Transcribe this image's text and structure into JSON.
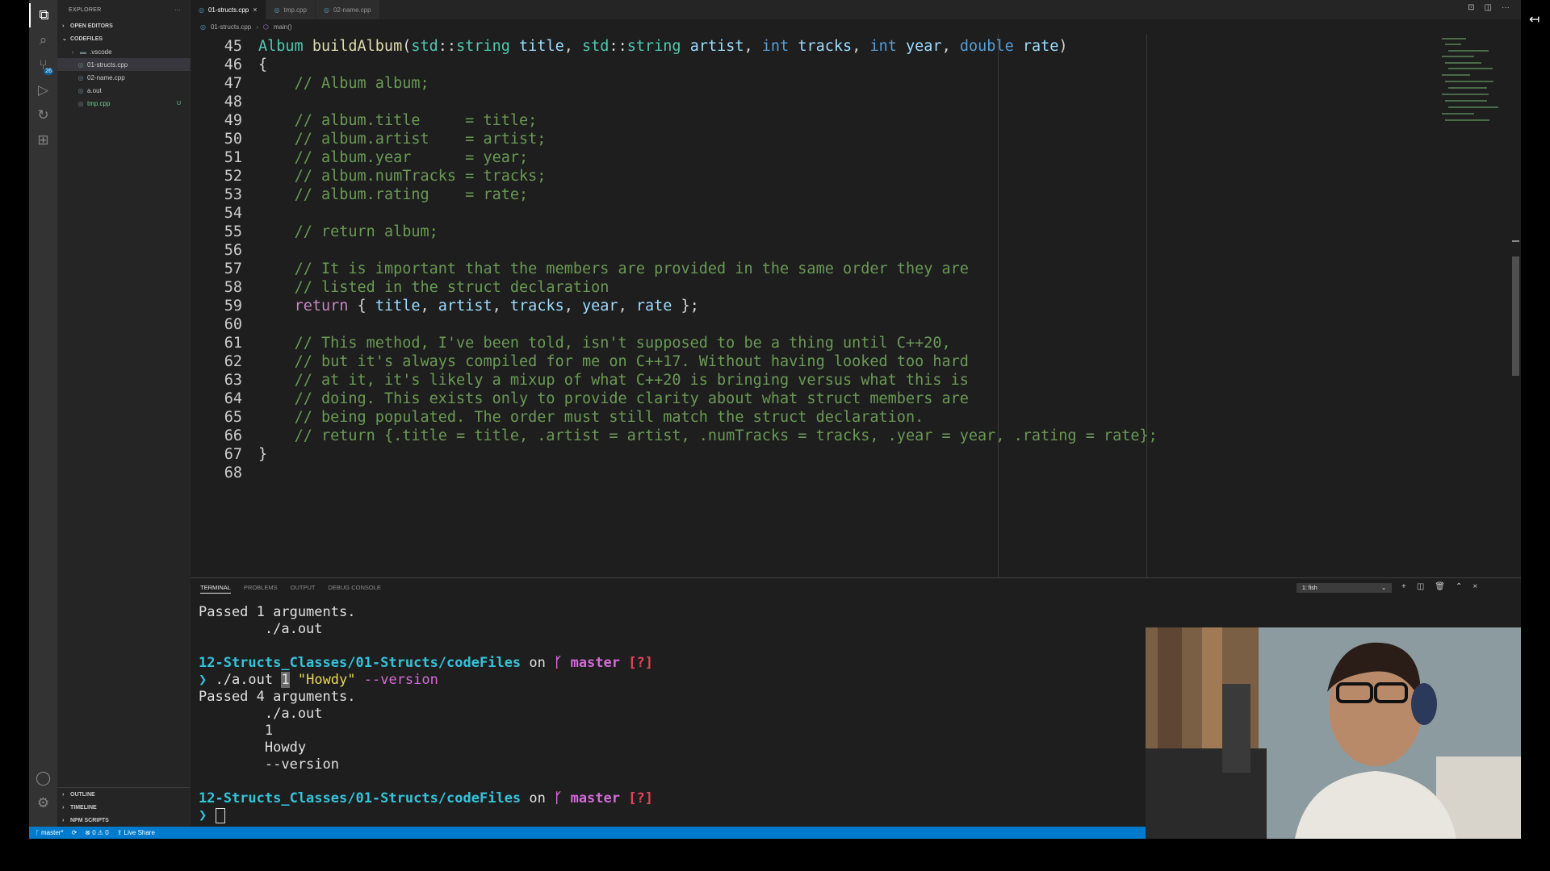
{
  "activity_bar": {
    "items": [
      {
        "name": "explorer-icon",
        "glyph": "⧉",
        "active": true
      },
      {
        "name": "search-icon",
        "glyph": "⌕"
      },
      {
        "name": "source-control-icon",
        "glyph": "⑂",
        "badge": "26"
      },
      {
        "name": "run-debug-icon",
        "glyph": "▷"
      },
      {
        "name": "live-share-icon",
        "glyph": "↻"
      },
      {
        "name": "extensions-icon",
        "glyph": "⊞"
      }
    ],
    "bottom": [
      {
        "name": "account-icon",
        "glyph": "◯"
      },
      {
        "name": "settings-gear-icon",
        "glyph": "⚙"
      }
    ]
  },
  "sidebar": {
    "title": "EXPLORER",
    "more": "···",
    "open_editors": "OPEN EDITORS",
    "folder": "CODEFILES",
    "items": [
      {
        "label": ".vscode",
        "kind": "folder"
      },
      {
        "label": "01-structs.cpp",
        "kind": "file",
        "selected": true
      },
      {
        "label": "02-name.cpp",
        "kind": "file"
      },
      {
        "label": "a.out",
        "kind": "file"
      },
      {
        "label": "tmp.cpp",
        "kind": "file",
        "untracked": true,
        "decoration": "U"
      }
    ],
    "outline": "OUTLINE",
    "timeline": "TIMELINE",
    "npm_scripts": "NPM SCRIPTS"
  },
  "tabs": [
    {
      "label": "01-structs.cpp",
      "active": true,
      "close": "×"
    },
    {
      "label": "tmp.cpp"
    },
    {
      "label": "02-name.cpp"
    }
  ],
  "breadcrumb": {
    "file": "01-structs.cpp",
    "symbol": "main()"
  },
  "code_lines": [
    {
      "n": "45",
      "tokens": [
        [
          "type",
          "Album "
        ],
        [
          "fn",
          "buildAlbum"
        ],
        [
          "p",
          "("
        ],
        [
          "ns",
          "std"
        ],
        [
          "p",
          "::"
        ],
        [
          "type",
          "string"
        ],
        [
          "p",
          " "
        ],
        [
          "var",
          "title"
        ],
        [
          "p",
          ", "
        ],
        [
          "ns",
          "std"
        ],
        [
          "p",
          "::"
        ],
        [
          "type",
          "string"
        ],
        [
          "p",
          " "
        ],
        [
          "var",
          "artist"
        ],
        [
          "p",
          ", "
        ],
        [
          "kw",
          "int"
        ],
        [
          "p",
          " "
        ],
        [
          "var",
          "tracks"
        ],
        [
          "p",
          ", "
        ],
        [
          "kw",
          "int"
        ],
        [
          "p",
          " "
        ],
        [
          "var",
          "year"
        ],
        [
          "p",
          ", "
        ],
        [
          "kw",
          "double"
        ],
        [
          "p",
          " "
        ],
        [
          "var",
          "rate"
        ],
        [
          "p",
          ")"
        ]
      ]
    },
    {
      "n": "46",
      "tokens": [
        [
          "p",
          "{"
        ]
      ]
    },
    {
      "n": "47",
      "tokens": [
        [
          "p",
          "    "
        ],
        [
          "com",
          "// Album album;"
        ]
      ]
    },
    {
      "n": "48",
      "tokens": []
    },
    {
      "n": "49",
      "tokens": [
        [
          "p",
          "    "
        ],
        [
          "com",
          "// album.title     = title;"
        ]
      ]
    },
    {
      "n": "50",
      "tokens": [
        [
          "p",
          "    "
        ],
        [
          "com",
          "// album.artist    = artist;"
        ]
      ]
    },
    {
      "n": "51",
      "tokens": [
        [
          "p",
          "    "
        ],
        [
          "com",
          "// album.year      = year;"
        ]
      ]
    },
    {
      "n": "52",
      "tokens": [
        [
          "p",
          "    "
        ],
        [
          "com",
          "// album.numTracks = tracks;"
        ]
      ]
    },
    {
      "n": "53",
      "tokens": [
        [
          "p",
          "    "
        ],
        [
          "com",
          "// album.rating    = rate;"
        ]
      ]
    },
    {
      "n": "54",
      "tokens": []
    },
    {
      "n": "55",
      "tokens": [
        [
          "p",
          "    "
        ],
        [
          "com",
          "// return album;"
        ]
      ]
    },
    {
      "n": "56",
      "tokens": []
    },
    {
      "n": "57",
      "tokens": [
        [
          "p",
          "    "
        ],
        [
          "com",
          "// It is important that the members are provided in the same order they are"
        ]
      ]
    },
    {
      "n": "58",
      "tokens": [
        [
          "p",
          "    "
        ],
        [
          "com",
          "// listed in the struct declaration"
        ]
      ]
    },
    {
      "n": "59",
      "tokens": [
        [
          "p",
          "    "
        ],
        [
          "kwc",
          "return"
        ],
        [
          "p",
          " { "
        ],
        [
          "var",
          "title"
        ],
        [
          "p",
          ", "
        ],
        [
          "var",
          "artist"
        ],
        [
          "p",
          ", "
        ],
        [
          "var",
          "tracks"
        ],
        [
          "p",
          ", "
        ],
        [
          "var",
          "year"
        ],
        [
          "p",
          ", "
        ],
        [
          "var",
          "rate"
        ],
        [
          "p",
          " };"
        ]
      ]
    },
    {
      "n": "60",
      "tokens": []
    },
    {
      "n": "61",
      "tokens": [
        [
          "p",
          "    "
        ],
        [
          "com",
          "// This method, I've been told, isn't supposed to be a thing until C++20,"
        ]
      ]
    },
    {
      "n": "62",
      "tokens": [
        [
          "p",
          "    "
        ],
        [
          "com",
          "// but it's always compiled for me on C++17. Without having looked too hard"
        ]
      ]
    },
    {
      "n": "63",
      "tokens": [
        [
          "p",
          "    "
        ],
        [
          "com",
          "// at it, it's likely a mixup of what C++20 is bringing versus what this is"
        ]
      ]
    },
    {
      "n": "64",
      "tokens": [
        [
          "p",
          "    "
        ],
        [
          "com",
          "// doing. This exists only to provide clarity about what struct members are"
        ]
      ]
    },
    {
      "n": "65",
      "tokens": [
        [
          "p",
          "    "
        ],
        [
          "com",
          "// being populated. The order must still match the struct declaration."
        ]
      ]
    },
    {
      "n": "66",
      "tokens": [
        [
          "p",
          "    "
        ],
        [
          "com",
          "// return {.title = title, .artist = artist, .numTracks = tracks, .year = year, .rating = rate};"
        ]
      ]
    },
    {
      "n": "67",
      "tokens": [
        [
          "p",
          "}"
        ]
      ]
    },
    {
      "n": "68",
      "tokens": []
    }
  ],
  "panel": {
    "tabs": [
      "TERMINAL",
      "PROBLEMS",
      "OUTPUT",
      "DEBUG CONSOLE"
    ],
    "terminal_select": "1: fish",
    "actions": [
      "+",
      "◫",
      "🗑",
      "⌃",
      "×"
    ]
  },
  "terminal": {
    "path": "12-Structs_Classes/01-Structs/codeFiles",
    "on": " on ",
    "branch_icon": "ᚴ",
    "branch": "master",
    "status": "[?]",
    "prompt": "❯",
    "out1": "Passed 1 arguments.",
    "out1_a": "        ./a.out",
    "cmd_prog": " ./a.out ",
    "cmd_arg1": "1",
    "cmd_arg2": " \"Howdy\"",
    "cmd_arg3": " --version",
    "out2": "Passed 4 arguments.",
    "out2_a": "        ./a.out",
    "out2_b": "        1",
    "out2_c": "        Howdy",
    "out2_d": "        --version"
  },
  "status_bar": {
    "branch": "ᚴ master*",
    "sync": "⟳",
    "problems": "⊗ 0 ⚠ 0",
    "live_share": "⇪ Live Share"
  },
  "editor_actions": [
    "⊡",
    "◫",
    "···"
  ],
  "colors": {
    "accent": "#007acc",
    "comment": "#6a9955",
    "keyword": "#569cd6",
    "type": "#4ec9b0"
  }
}
